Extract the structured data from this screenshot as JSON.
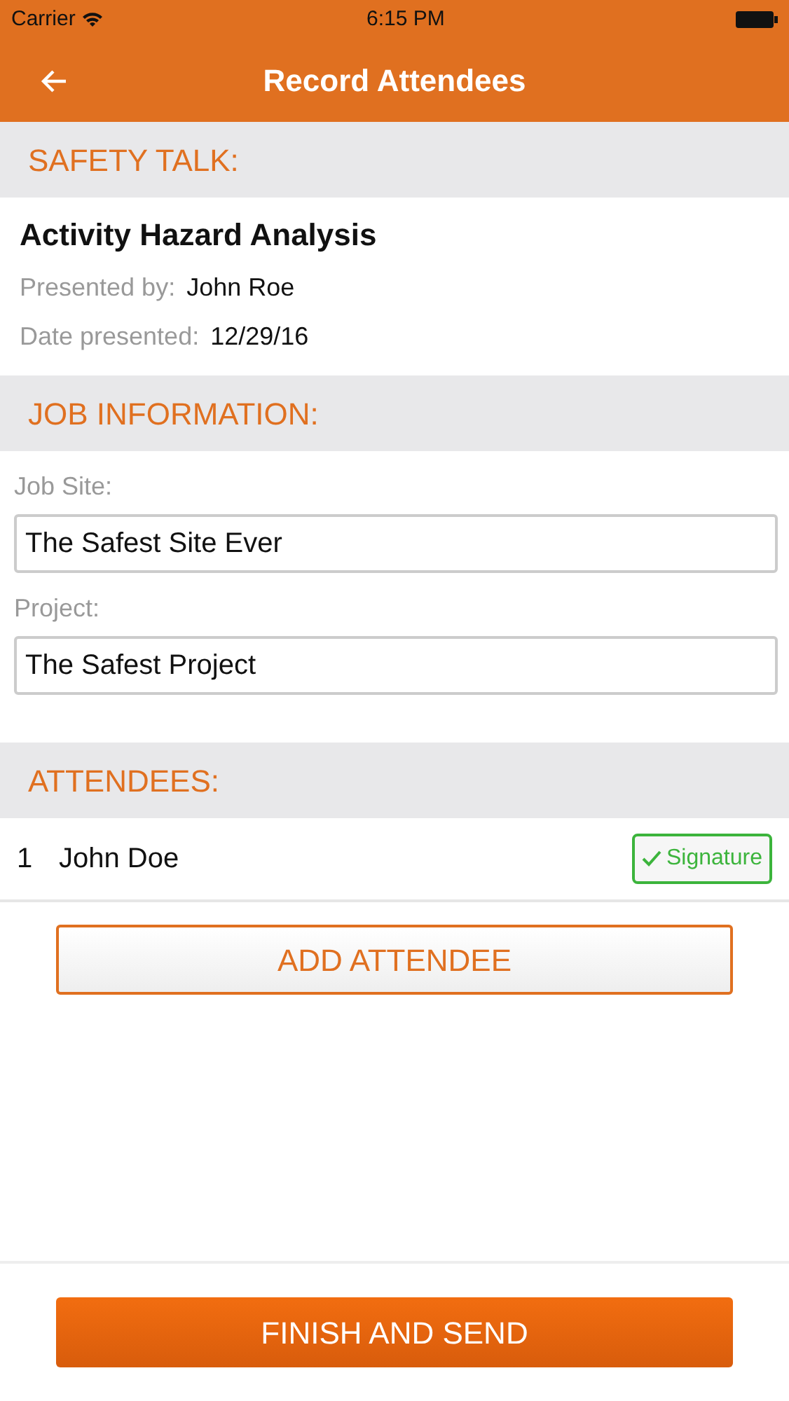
{
  "status_bar": {
    "carrier": "Carrier",
    "time": "6:15 PM"
  },
  "nav": {
    "title": "Record Attendees"
  },
  "safety_talk": {
    "heading": "SAFETY TALK:",
    "title": "Activity Hazard Analysis",
    "fields": [
      {
        "label": "Presented by:",
        "value": "John Roe"
      },
      {
        "label": "Date presented:",
        "value": "12/29/16"
      }
    ]
  },
  "job_information": {
    "heading": "JOB INFORMATION:",
    "fields": [
      {
        "label": "Job Site:",
        "value": "The Safest Site Ever"
      },
      {
        "label": "Project:",
        "value": "The Safest Project"
      }
    ]
  },
  "attendees": {
    "heading": "ATTENDEES:",
    "rows": [
      {
        "number": "1",
        "name": "John Doe",
        "signature": "Signature",
        "signed": true
      }
    ]
  },
  "add_button": "ADD ATTENDEE",
  "finish_button": "FINISH AND SEND"
}
